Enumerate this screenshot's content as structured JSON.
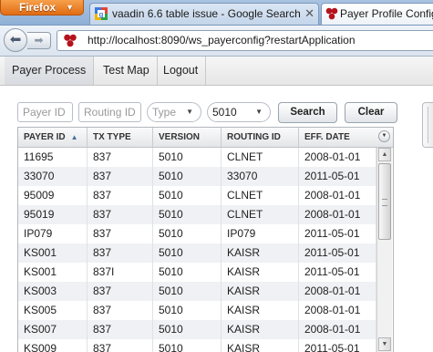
{
  "browser": {
    "menu_label": "Firefox",
    "tabs": [
      {
        "title": "vaadin 6.6 table issue - Google Search",
        "favicon": "google-icon"
      },
      {
        "title": "Payer Profile Configurator",
        "favicon": "vaadin-app-icon"
      }
    ],
    "url": "http://localhost:8090/ws_payerconfig?restartApplication"
  },
  "app": {
    "menu": [
      "Payer Process",
      "Test Map",
      "Logout"
    ],
    "filters": {
      "payer_id_placeholder": "Payer ID",
      "routing_id_placeholder": "Routing ID",
      "type_placeholder": "Type",
      "version_value": "5010",
      "search_label": "Search",
      "clear_label": "Clear"
    },
    "table": {
      "columns": [
        "PAYER ID",
        "TX TYPE",
        "VERSION",
        "ROUTING ID",
        "EFF. DATE"
      ],
      "sorted_column": "PAYER ID",
      "sort_direction": "ascending",
      "rows": [
        [
          "11695",
          "837",
          "5010",
          "CLNET",
          "2008-01-01"
        ],
        [
          "33070",
          "837",
          "5010",
          "33070",
          "2011-05-01"
        ],
        [
          "95009",
          "837",
          "5010",
          "CLNET",
          "2008-01-01"
        ],
        [
          "95019",
          "837",
          "5010",
          "CLNET",
          "2008-01-01"
        ],
        [
          "IP079",
          "837",
          "5010",
          "IP079",
          "2011-05-01"
        ],
        [
          "KS001",
          "837",
          "5010",
          "KAISR",
          "2011-05-01"
        ],
        [
          "KS001",
          "837I",
          "5010",
          "KAISR",
          "2011-05-01"
        ],
        [
          "KS003",
          "837",
          "5010",
          "KAISR",
          "2008-01-01"
        ],
        [
          "KS005",
          "837",
          "5010",
          "KAISR",
          "2008-01-01"
        ],
        [
          "KS007",
          "837",
          "5010",
          "KAISR",
          "2008-01-01"
        ],
        [
          "KS009",
          "837",
          "5010",
          "KAISR",
          "2011-05-01"
        ]
      ]
    }
  }
}
